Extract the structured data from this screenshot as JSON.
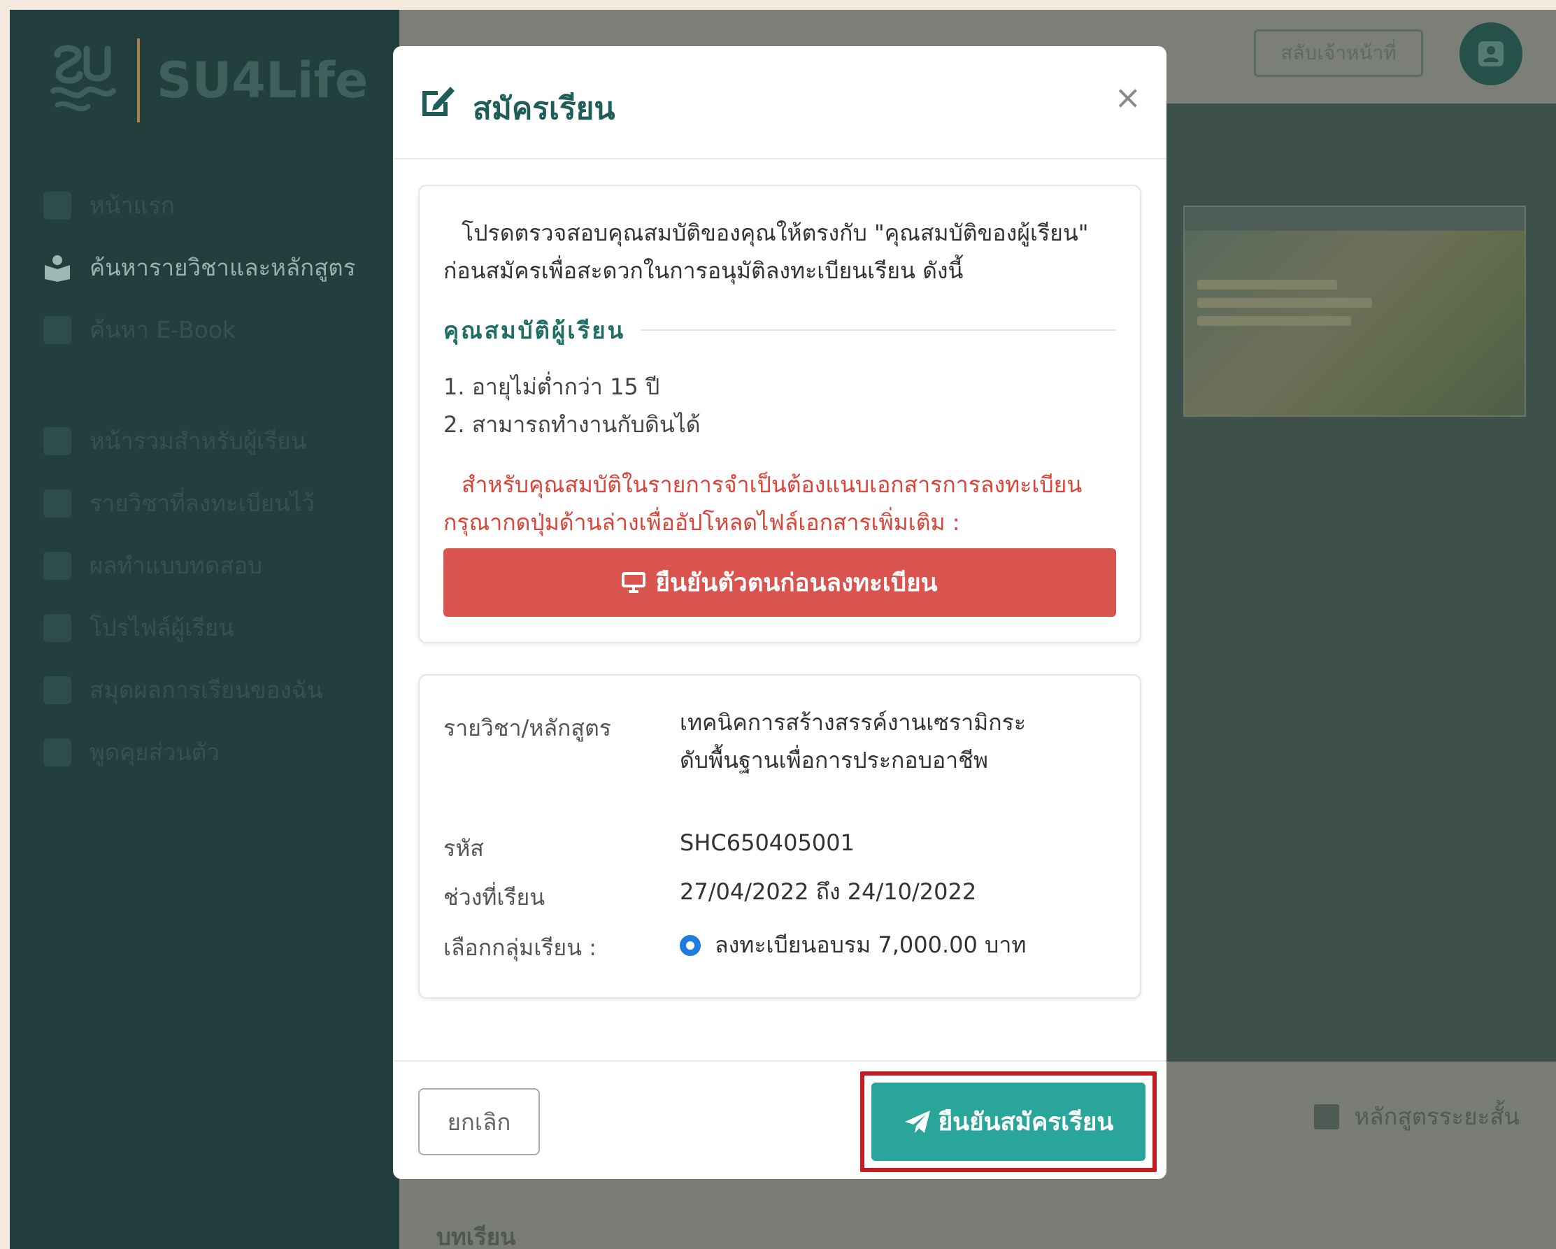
{
  "sidebar": {
    "brand": "SU4Life",
    "items": [
      {
        "label": "หน้าแรก",
        "icon": "home-icon"
      },
      {
        "label": "ค้นหารายวิชาและหลักสูตร",
        "icon": "book-reader-icon"
      },
      {
        "label": "ค้นหา E-Book",
        "icon": "ebook-icon"
      },
      {
        "label": "หน้ารวมสำหรับผู้เรียน",
        "icon": "dashboard-icon"
      },
      {
        "label": "รายวิชาที่ลงทะเบียนไว้",
        "icon": "enrolled-icon"
      },
      {
        "label": "ผลทำแบบทดสอบ",
        "icon": "quiz-result-icon"
      },
      {
        "label": "โปรไฟล์ผู้เรียน",
        "icon": "profile-icon"
      },
      {
        "label": "สมุดผลการเรียนของฉัน",
        "icon": "transcript-icon"
      },
      {
        "label": "พูดคุยส่วนตัว",
        "icon": "chat-icon"
      }
    ]
  },
  "topbar": {
    "switch_label": "สลับเจ้าหน้าที่"
  },
  "background": {
    "short_course": "หลักสูตรระยะสั้น",
    "lessons_title": "บทเรียน"
  },
  "modal": {
    "title": "สมัครเรียน",
    "close": "×",
    "intro": "โปรดตรวจสอบคุณสมบัติของคุณให้ตรงกับ \"คุณสมบัติของผู้เรียน\" ก่อนสมัครเพื่อสะดวกในการอนุมัติลงทะเบียนเรียน ดังนี้",
    "qual_heading": "คุณสมบัติผู้เรียน",
    "qualifications": [
      "1. อายุไม่ต่ำกว่า 15 ปี",
      "2. สามารถทำงานกับดินได้"
    ],
    "notice": "สำหรับคุณสมบัติในรายการจำเป็นต้องแนบเอกสารการลงทะเบียน กรุณากดปุ่มด้านล่างเพื่ออัปโหลดไฟล์เอกสารเพิ่มเติม :",
    "verify_button": "ยืนยันตัวตนก่อนลงทะเบียน",
    "details": {
      "course_label": "รายวิชา/หลักสูตร",
      "course_value": "เทคนิคการสร้างสรรค์งานเซรามิกระดับพื้นฐานเพื่อการประกอบอาชีพ",
      "code_label": "รหัส",
      "code_value": "SHC650405001",
      "period_label": "ช่วงที่เรียน",
      "period_value": "27/04/2022 ถึง 24/10/2022",
      "group_label": "เลือกกลุ่มเรียน :",
      "group_option": "ลงทะเบียนอบรม 7,000.00 บาท"
    },
    "cancel_button": "ยกเลิก",
    "confirm_button": "ยืนยันสมัครเรียน"
  },
  "colors": {
    "sidebar_bg": "#223f3d",
    "accent_teal": "#2aa59a",
    "danger": "#d9534f",
    "highlight": "#c41d21",
    "title": "#1f5e58"
  }
}
